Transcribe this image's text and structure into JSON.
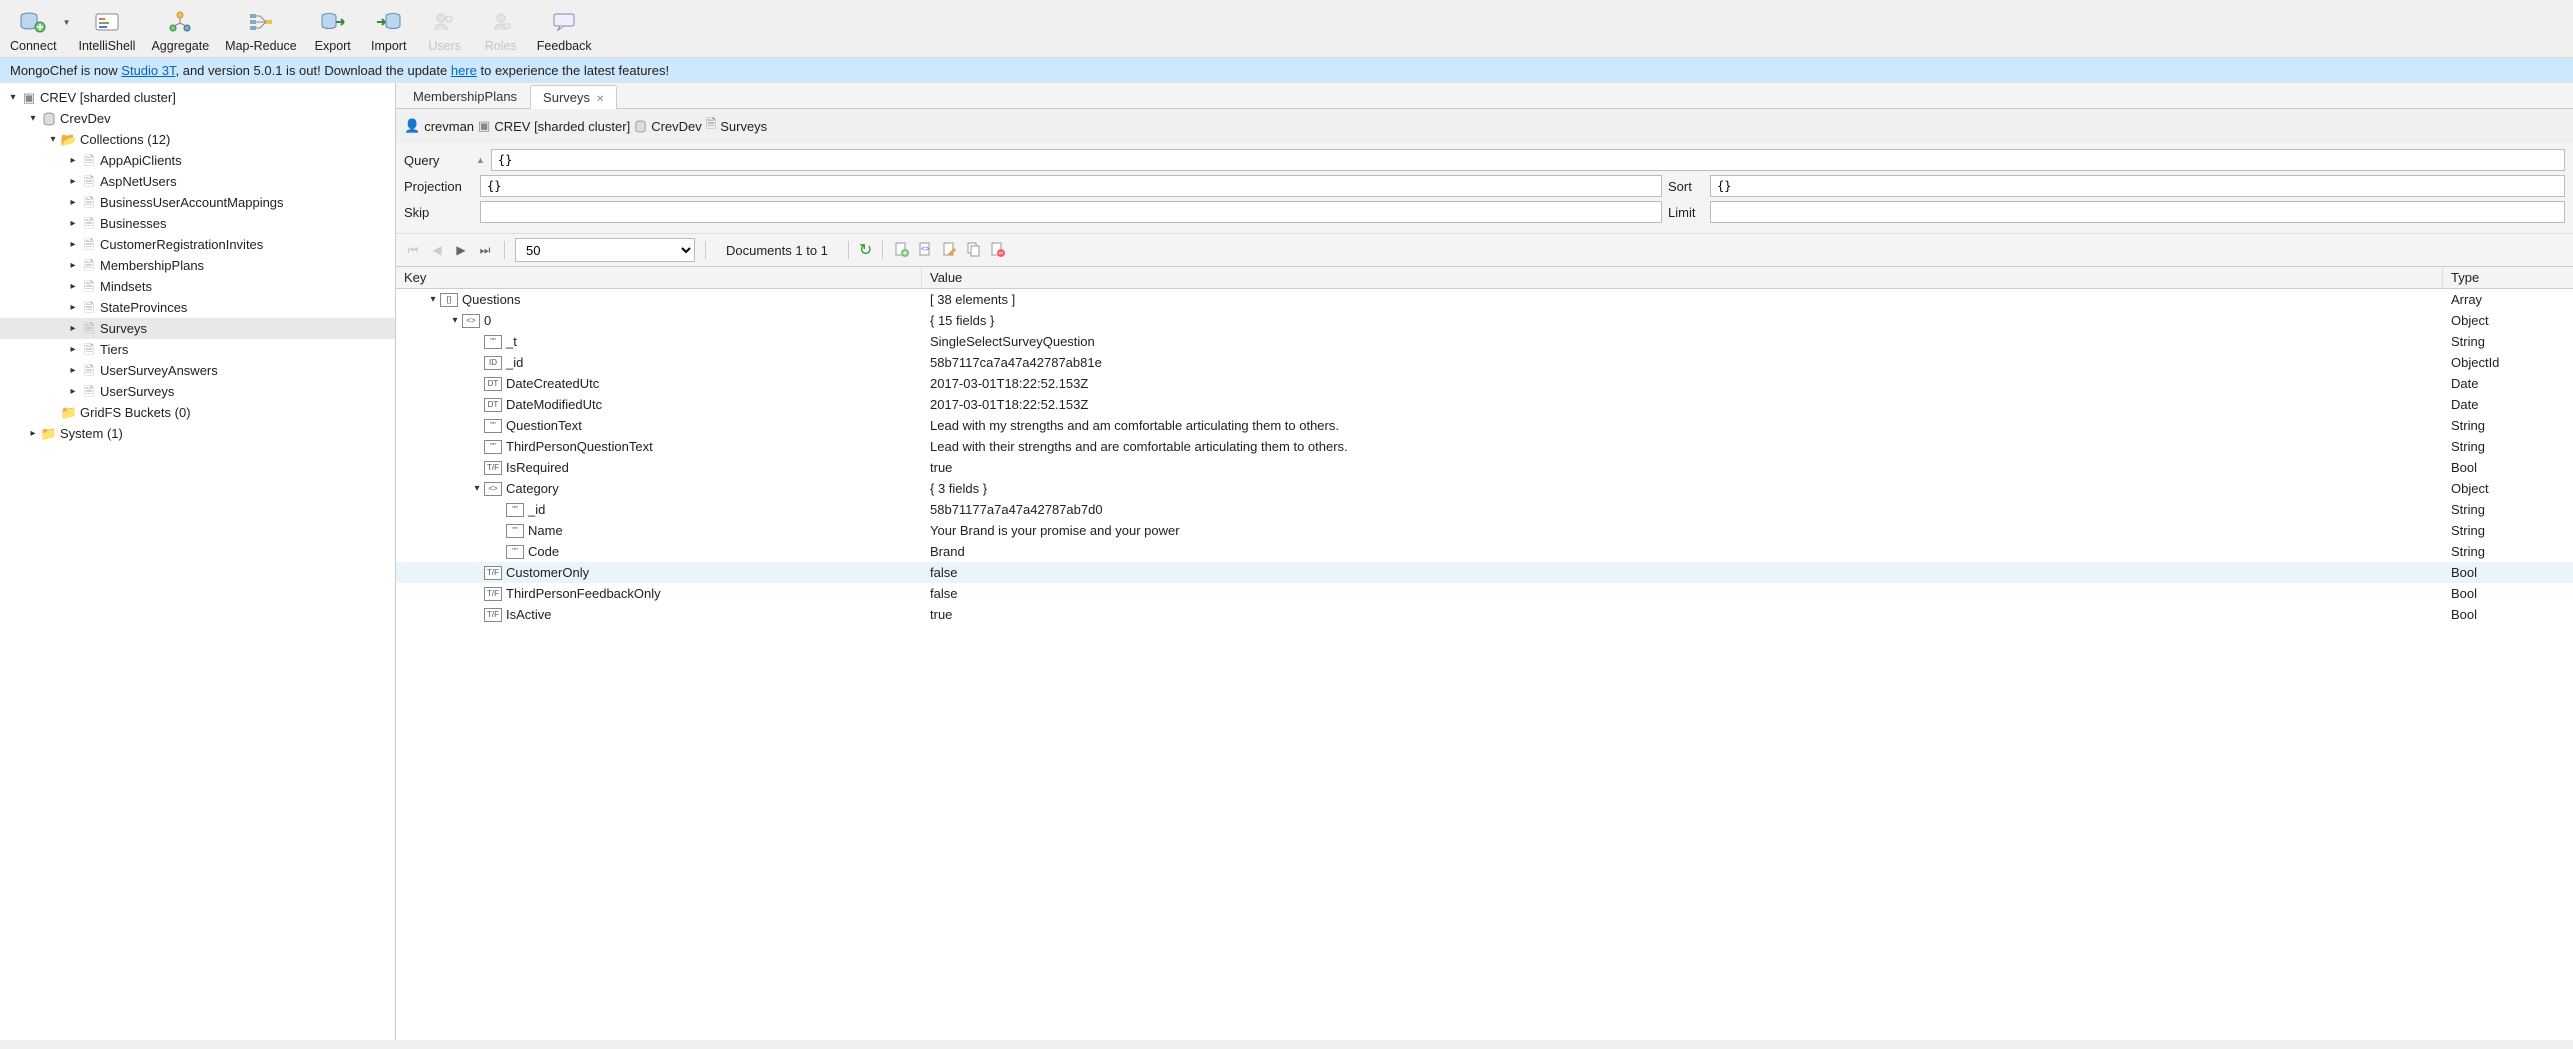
{
  "toolbar": {
    "connect": "Connect",
    "intellishell": "IntelliShell",
    "aggregate": "Aggregate",
    "mapreduce": "Map-Reduce",
    "export": "Export",
    "import": "Import",
    "users": "Users",
    "roles": "Roles",
    "feedback": "Feedback"
  },
  "banner": {
    "text1": "MongoChef is now ",
    "link1": "Studio 3T",
    "text2": ", and version 5.0.1 is out! Download the update ",
    "link2": "here",
    "text3": " to experience the latest features!"
  },
  "tree": {
    "root": "CREV [sharded cluster]",
    "db": "CrevDev",
    "collections_label": "Collections (12)",
    "items": [
      "AppApiClients",
      "AspNetUsers",
      "BusinessUserAccountMappings",
      "Businesses",
      "CustomerRegistrationInvites",
      "MembershipPlans",
      "Mindsets",
      "StateProvinces",
      "Surveys",
      "Tiers",
      "UserSurveyAnswers",
      "UserSurveys"
    ],
    "gridfs": "GridFS Buckets (0)",
    "system": "System (1)"
  },
  "tabs": {
    "t1": "MembershipPlans",
    "t2": "Surveys"
  },
  "breadcrumb": {
    "user": "crevman",
    "cluster": "CREV [sharded cluster]",
    "db": "CrevDev",
    "coll": "Surveys"
  },
  "query": {
    "label_query": "Query",
    "label_projection": "Projection",
    "label_skip": "Skip",
    "label_sort": "Sort",
    "label_limit": "Limit",
    "query_value": "{}",
    "projection_value": "{}",
    "sort_value": "{}",
    "skip_value": "",
    "limit_value": ""
  },
  "nav": {
    "page_size": "50",
    "doc_count": "Documents 1 to 1"
  },
  "results": {
    "header_key": "Key",
    "header_value": "Value",
    "header_type": "Type",
    "rows": [
      {
        "indent": 1,
        "caret": "down",
        "icon": "[]",
        "key": "Questions",
        "value": "[ 38 elements ]",
        "type": "Array"
      },
      {
        "indent": 2,
        "caret": "down",
        "icon": "<>",
        "key": "0",
        "value": "{ 15 fields }",
        "type": "Object"
      },
      {
        "indent": 3,
        "caret": "",
        "icon": "\"\"",
        "key": "_t",
        "value": "SingleSelectSurveyQuestion",
        "type": "String"
      },
      {
        "indent": 3,
        "caret": "",
        "icon": "ID",
        "key": "_id",
        "value": "58b7117ca7a47a42787ab81e",
        "type": "ObjectId"
      },
      {
        "indent": 3,
        "caret": "",
        "icon": "DT",
        "key": "DateCreatedUtc",
        "value": "2017-03-01T18:22:52.153Z",
        "type": "Date"
      },
      {
        "indent": 3,
        "caret": "",
        "icon": "DT",
        "key": "DateModifiedUtc",
        "value": "2017-03-01T18:22:52.153Z",
        "type": "Date"
      },
      {
        "indent": 3,
        "caret": "",
        "icon": "\"\"",
        "key": "QuestionText",
        "value": "Lead with my strengths and am comfortable articulating them to others.",
        "type": "String"
      },
      {
        "indent": 3,
        "caret": "",
        "icon": "\"\"",
        "key": "ThirdPersonQuestionText",
        "value": "Lead with their strengths and are comfortable articulating them to others.",
        "type": "String"
      },
      {
        "indent": 3,
        "caret": "",
        "icon": "T/F",
        "key": "IsRequired",
        "value": "true",
        "type": "Bool"
      },
      {
        "indent": 3,
        "caret": "down",
        "icon": "<>",
        "key": "Category",
        "value": "{ 3 fields }",
        "type": "Object"
      },
      {
        "indent": 4,
        "caret": "",
        "icon": "\"\"",
        "key": "_id",
        "value": "58b71177a7a47a42787ab7d0",
        "type": "String"
      },
      {
        "indent": 4,
        "caret": "",
        "icon": "\"\"",
        "key": "Name",
        "value": "Your Brand is your promise and your power",
        "type": "String"
      },
      {
        "indent": 4,
        "caret": "",
        "icon": "\"\"",
        "key": "Code",
        "value": "Brand",
        "type": "String"
      },
      {
        "indent": 3,
        "caret": "",
        "icon": "T/F",
        "key": "CustomerOnly",
        "value": "false",
        "type": "Bool",
        "highlight": true
      },
      {
        "indent": 3,
        "caret": "",
        "icon": "T/F",
        "key": "ThirdPersonFeedbackOnly",
        "value": "false",
        "type": "Bool"
      },
      {
        "indent": 3,
        "caret": "",
        "icon": "T/F",
        "key": "IsActive",
        "value": "true",
        "type": "Bool"
      }
    ]
  }
}
